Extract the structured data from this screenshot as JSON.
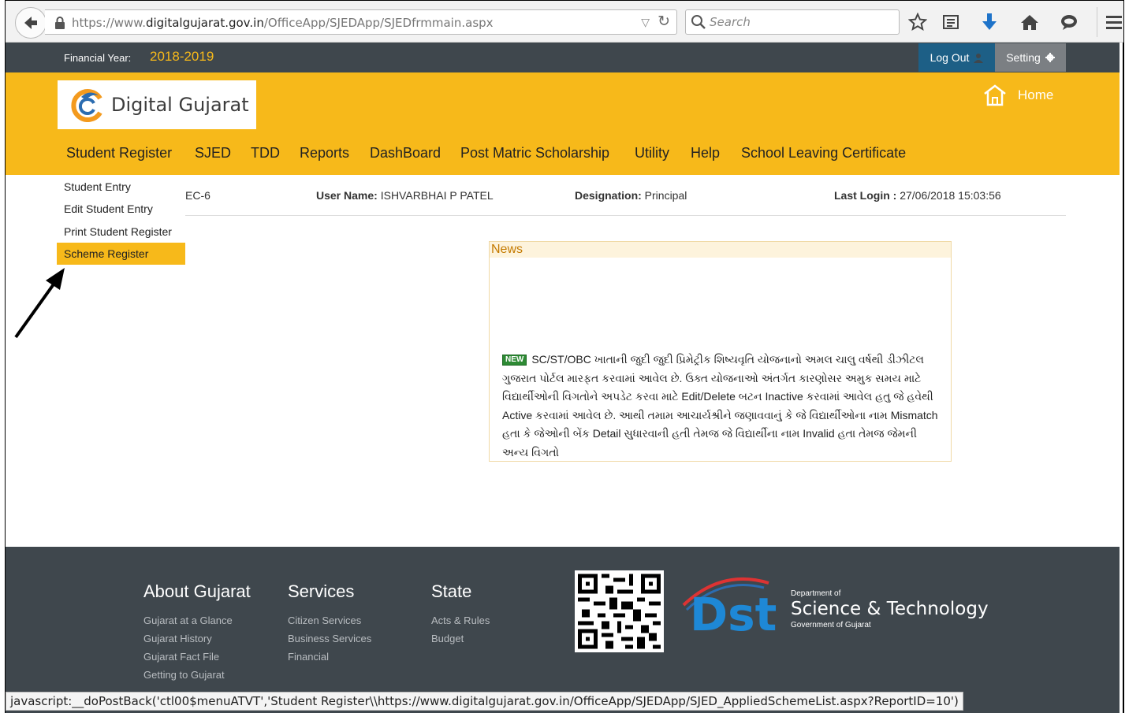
{
  "browser": {
    "url_prefix": "https://www.",
    "url_domain": "digitalgujarat.gov.in",
    "url_path": "/OfficeApp/SJEDApp/SJEDfrmmain.aspx",
    "search_placeholder": "Search"
  },
  "topbar": {
    "fy_label": "Financial Year:",
    "fy_value": "2018-2019",
    "logout_label": "Log Out",
    "setting_label": "Setting"
  },
  "header": {
    "logo_text": "Digital Gujarat",
    "home_label": "Home",
    "nav": [
      "Student Register",
      "SJED",
      "TDD",
      "Reports",
      "DashBoard",
      "Post Matric Scholarship",
      "Utility",
      "Help",
      "School Leaving Certificate"
    ]
  },
  "dropdown": {
    "items": [
      "Student Entry",
      "Edit Student Entry",
      "Print Student Register",
      "Scheme Register"
    ],
    "active_index": 3
  },
  "info": {
    "partial_code": "EC-6",
    "user_name_label": "User Name:",
    "user_name_value": "ISHVARBHAI P PATEL",
    "designation_label": "Designation:",
    "designation_value": "Principal",
    "last_login_label": "Last Login :",
    "last_login_value": "27/06/2018 15:03:56"
  },
  "news": {
    "title": "News",
    "badge": "NEW",
    "text": "SC/ST/OBC ખાતાની જુદી જુદી પ્રિમેટ્રીક શિષ્યવૃતિ યોજનાનો અમલ ચાલુ વર્ષથી ડીઝીટલ ગુજરાત પોર્ટલ મારફત કરવામાં આવેલ છે. ઉક્ત યોજનાઓ અંતર્ગત કારણોસર અમુક સમય માટે વિદ્યાર્થીઓની વિગતોને અપડેટ કરવા માટે Edit/Delete બટન Inactive કરવામાં આવેલ હતુ જે હવેથી Active કરવામાં આવેલ છે. આથી તમામ આચાર્યશ્રીને જણાવવાનું કે જે વિદ્યાર્થીઓના નામ Mismatch હતા કે જેઓની બેંક Detail સુધારવાની હતી તેમજ જે વિદ્યાર્થીના નામ Invalid હતા તેમજ જેમની અન્ય વિગતો"
  },
  "footer": {
    "columns": [
      {
        "title": "About Gujarat",
        "links": [
          "Gujarat at a Glance",
          "Gujarat History",
          "Gujarat Fact File",
          "Getting to Gujarat"
        ]
      },
      {
        "title": "Services",
        "links": [
          "Citizen Services",
          "Business Services",
          "Financial"
        ]
      },
      {
        "title": "State",
        "links": [
          "Acts & Rules",
          "Budget"
        ]
      }
    ],
    "dst_logo": "Dst",
    "dst_dept": "Department of",
    "dst_name": "Science & Technology",
    "dst_gov": "Government of Gujarat"
  },
  "statusbar": {
    "text": "javascript:__doPostBack('ctl00$menuATVT','Student Register\\\\https://www.digitalgujarat.gov.in/OfficeApp/SJEDApp/SJED_AppliedSchemeList.aspx?ReportID=10')"
  },
  "colors": {
    "accent": "#f7b91a",
    "dark_bar": "#3f474d",
    "logout_blue": "#1d5f86",
    "news_orange": "#c47a00"
  },
  "icons": {
    "back": "arrow-left-icon",
    "lock": "lock-icon",
    "reload": "reload-icon",
    "search": "search-icon",
    "bookmark": "star-icon",
    "reading_list": "reading-list-icon",
    "download": "download-icon",
    "home": "home-icon",
    "chat": "chat-icon",
    "menu": "hamburger-menu-icon",
    "user": "user-icon",
    "gear": "gear-icon",
    "annotation": "pointer-arrow-icon"
  }
}
